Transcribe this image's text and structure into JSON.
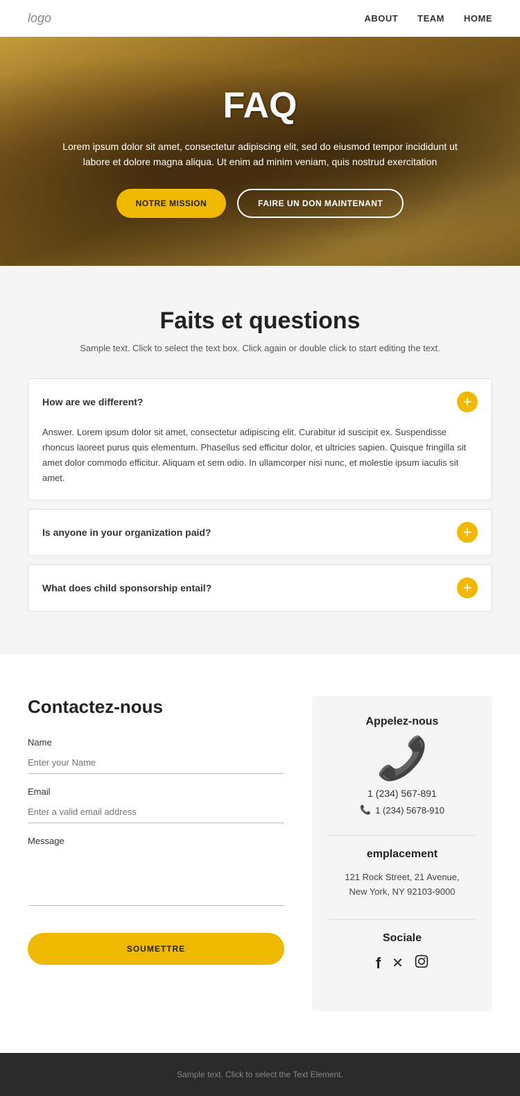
{
  "nav": {
    "logo": "logo",
    "links": [
      "ABOUT",
      "TEAM",
      "HOME"
    ]
  },
  "hero": {
    "title": "FAQ",
    "subtitle": "Lorem ipsum dolor sit amet, consectetur adipiscing elit, sed do eiusmod tempor incididunt ut labore et dolore magna aliqua. Ut enim ad minim veniam, quis nostrud exercitation",
    "btn1": "NOTRE MISSION",
    "btn2": "FAIRE UN DON MAINTENANT"
  },
  "faq": {
    "title": "Faits et questions",
    "subtitle": "Sample text. Click to select the text box. Click again or double click to start editing the text.",
    "items": [
      {
        "question": "How are we different?",
        "answer": "Answer. Lorem ipsum dolor sit amet, consectetur adipiscing elit. Curabitur id suscipit ex. Suspendisse rhoncus laoreet purus quis elementum. Phasellus sed efficitur dolor, et ultricies sapien. Quisque fringilla sit amet dolor commodo efficitur. Aliquam et sem odio. In ullamcorper nisi nunc, et molestie ipsum iaculis sit amet.",
        "open": true
      },
      {
        "question": "Is anyone in your organization paid?",
        "answer": "",
        "open": false
      },
      {
        "question": "What does child sponsorship entail?",
        "answer": "",
        "open": false
      }
    ]
  },
  "contact": {
    "title": "Contactez-nous",
    "name_label": "Name",
    "name_placeholder": "Enter your Name",
    "email_label": "Email",
    "email_placeholder": "Enter a valid email address",
    "message_label": "Message",
    "submit_label": "SOUMETTRE"
  },
  "info": {
    "call_title": "Appelez-nous",
    "phone1": "1 (234) 567-891",
    "phone2": "1 (234) 5678-910",
    "location_title": "emplacement",
    "address": "121 Rock Street, 21 Avenue,\nNew York, NY 92103-9000",
    "social_title": "Sociale"
  },
  "footer": {
    "text": "Sample text. Click to select the Text Element."
  }
}
